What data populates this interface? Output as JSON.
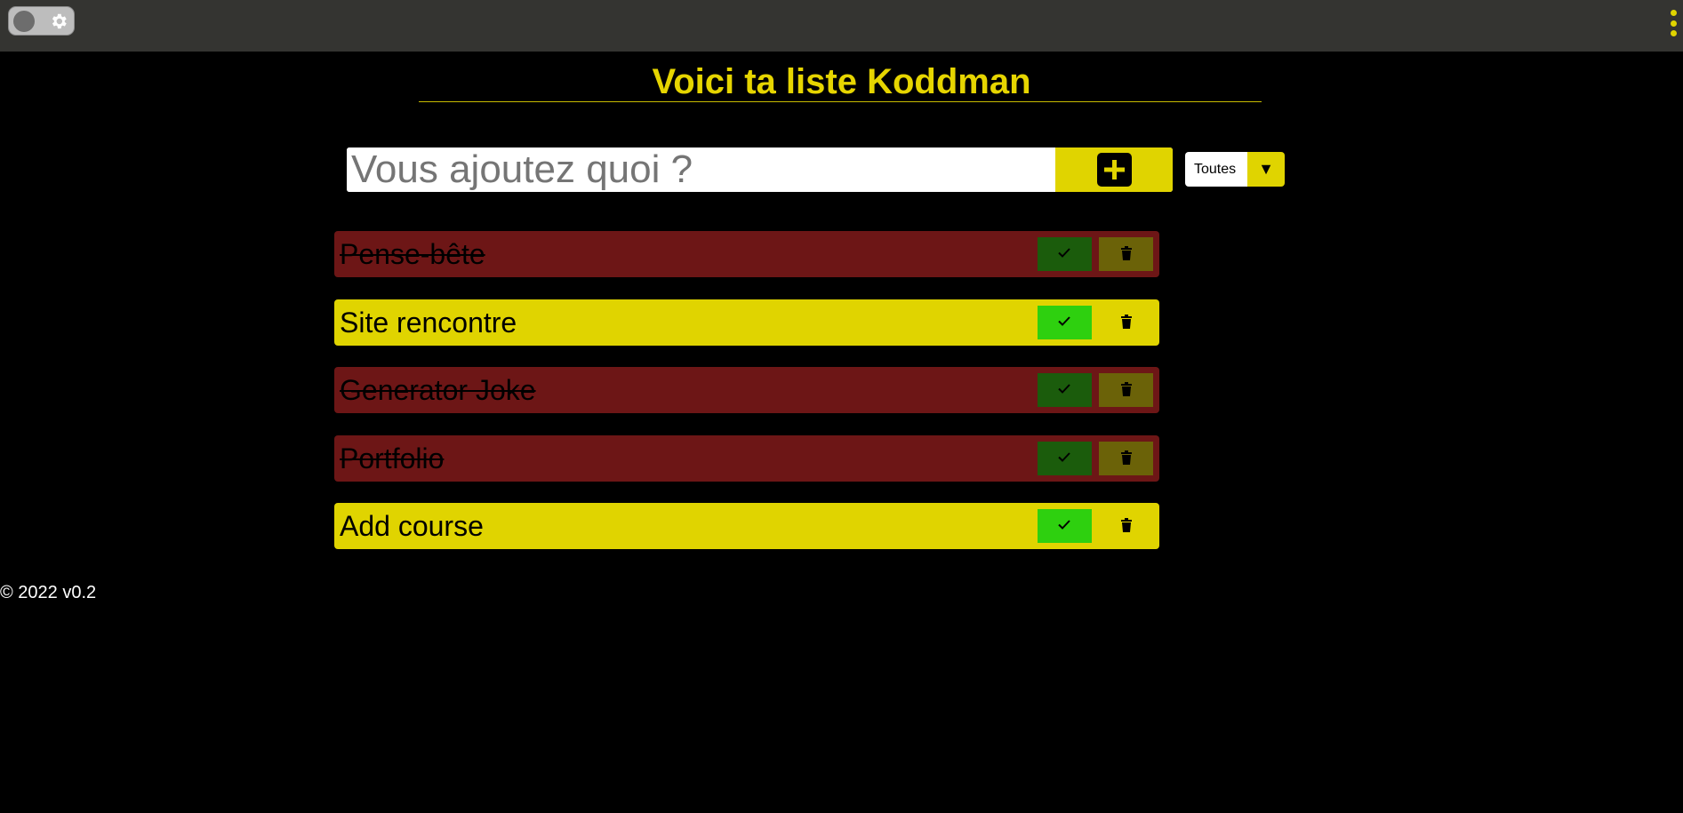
{
  "header": {
    "theme_toggle": {
      "icon": "gear-icon",
      "state": "off"
    },
    "menu": {
      "icon": "kebab-menu-icon"
    }
  },
  "main": {
    "title": "Voici ta liste Koddman",
    "add_form": {
      "input_placeholder": "Vous ajoutez quoi ?",
      "input_value": "",
      "add_button_icon": "plus-icon"
    },
    "filter": {
      "selected": "Toutes",
      "arrow": "▼"
    },
    "todos": [
      {
        "label": "Pense-bête",
        "completed": true
      },
      {
        "label": "Site rencontre",
        "completed": false
      },
      {
        "label": "Generator Joke",
        "completed": true
      },
      {
        "label": "Portfolio",
        "completed": true
      },
      {
        "label": "Add course",
        "completed": false
      }
    ]
  },
  "footer": {
    "text": "© 2022 v0.2"
  },
  "colors": {
    "accent": "#e0d400",
    "done_row": "#6d1616",
    "check_active": "#2ed00f",
    "check_done": "#1b5c0c",
    "trash_done": "#6b6208",
    "topbar": "#343431",
    "background": "#000000"
  }
}
